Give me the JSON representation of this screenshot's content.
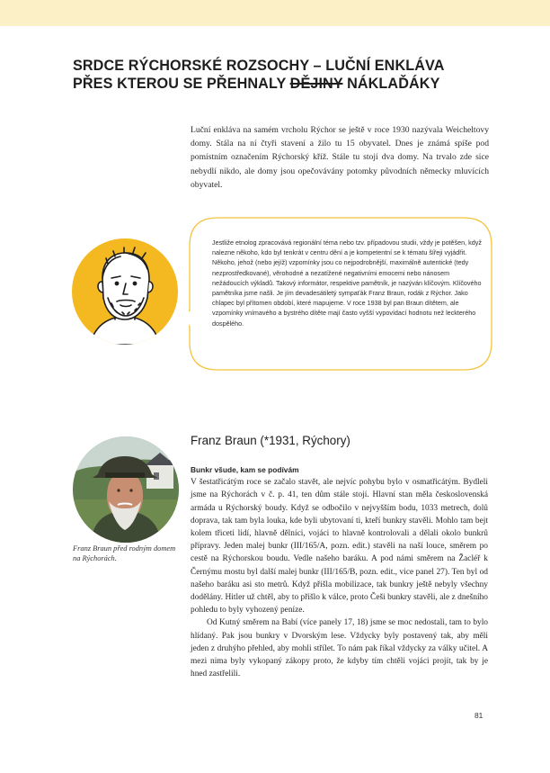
{
  "title": {
    "line1": "SRDCE RÝCHORSKÉ ROZSOCHY – LUČNÍ ENKLÁVA",
    "line2_a": "PŘES KTEROU SE PŘEHNALY ",
    "line2_struck": "DĚJINY",
    "line2_b": " NÁKLAĎÁKY"
  },
  "intro": "Luční enkláva na samém vrcholu Rýchor se ještě v roce 1930 nazývala Weicheltovy domy. Stála na ní čtyři stavení a žilo tu 15 obyvatel. Dnes je známá spíše pod pomístním označením Rýchorský kříž. Stále tu stojí dva domy. Na trvalo zde sice nebydlí nikdo, ale domy jsou opečovávány potomky původních německy mluvících obyvatel.",
  "bubble_text": "Jestliže etnolog zpracovává regionální téma nebo tzv. případovou studii, vždy je potěšen, když nalezne někoho, kdo byl tenkrát v centru dění a je kompetentní se k tématu šířeji vyjádřit. Někoho, jehož (nebo jejíž) vzpomínky jsou co nejpodrobnější, maximálně autentické (tedy nezprostředkované), věrohodné a nezatížené negativními emocemi nebo nánosem nežádoucích výkladů. Takový informátor, respektive pamětník, je nazýván klíčovým. Klíčového pamětníka jsme našli. Je jím devadesátiletý sympaťák Franz Braun, rodák z Rýchor. Jako chlapec byl přítomen období, které mapujeme. V roce 1938 byl pan Braun dítětem, ale vzpomínky vnímavého a bystrého dítěte mají často vyšší vypovídací hodnotu než leckterého dospělého.",
  "caption": "Franz Braun před rodným domem na Rýchorách.",
  "section_title": "Franz Braun (*1931, Rýchory)",
  "subhead": "Bunkr všude, kam se podívám",
  "para1": "V šestatřicátým roce se začalo stavět, ale nejvíc pohybu bylo v osmatřicátým. Bydleli jsme na Rýchorách v č. p. 41, ten dům stále stojí. Hlavní stan měla československá armáda u Rýchorský boudy. Když se odbočilo v nejvyšším bodu, 1033 metrech, dolů doprava, tak tam byla louka, kde byli ubytovaní ti, kteří bunkry stavěli. Mohlo tam bejt kolem třiceti lidí, hlavně dělníci, vojáci to hlavně kontrolovali a dělali okolo bunkrů přípravy. Jeden malej bunkr (III/165/A, pozn. edit.) stavěli na naší louce, směrem po cestě na Rýchorskou boudu. Vedle našeho baráku. A pod námi směrem na Žacléř k Černýmu mostu byl další malej bunkr (III/165/B, pozn. edit., vice panel 27). Ten byl od našeho baráku asi sto metrů. Když přišla mobilizace, tak bunkry ještě nebyly všechny dodělány. Hitler už chtěl, aby to přišlo k válce, proto Češi bunkry stavěli, ale z dnešního pohledu to byly vyhozený peníze.",
  "para2": "Od Kutný směrem na Babí (více panely 17, 18) jsme se moc nedostali, tam to bylo hlídaný. Pak jsou bunkry v Dvorským lese. Vždycky byly postavený tak, aby měli jeden z druhýho přehled, aby mohli střílet. To nám pak říkal vždycky za války učitel. A mezi nima byly vykopaný zákopy proto, že kdyby tím chtěli vojáci projít, tak by je hned zastřelili.",
  "page_number": "81",
  "colors": {
    "accent": "#f5c33b",
    "topbar": "#fbf0c6",
    "avatar_fill": "#f4b920"
  },
  "icons": {
    "avatar": "bearded-man-illustration-icon",
    "photo": "portrait-photo"
  }
}
